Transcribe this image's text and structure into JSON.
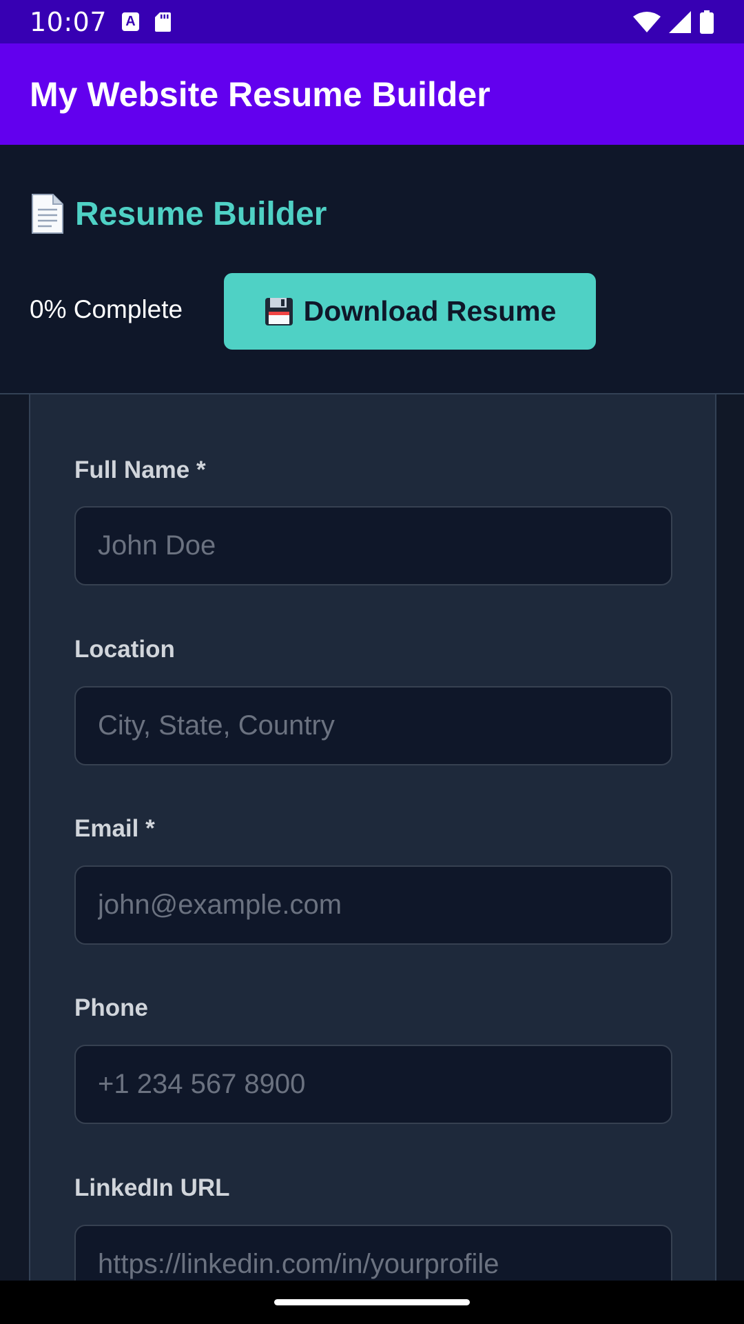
{
  "status_bar": {
    "time": "10:07",
    "left_icons": [
      "text-input-icon",
      "sd-card-icon"
    ],
    "right_icons": [
      "wifi-icon",
      "signal-icon",
      "battery-icon"
    ]
  },
  "app_bar": {
    "title": "My Website Resume Builder"
  },
  "header": {
    "icon": "document-icon",
    "title": "Resume Builder",
    "progress_text": "0% Complete",
    "download_button": {
      "icon": "floppy-disk-icon",
      "label": "Download Resume"
    }
  },
  "form": {
    "fields": [
      {
        "label": "Full Name *",
        "placeholder": "John Doe",
        "value": ""
      },
      {
        "label": "Location",
        "placeholder": "City, State, Country",
        "value": ""
      },
      {
        "label": "Email *",
        "placeholder": "john@example.com",
        "value": ""
      },
      {
        "label": "Phone",
        "placeholder": "+1 234 567 8900",
        "value": ""
      },
      {
        "label": "LinkedIn URL",
        "placeholder": "https://linkedin.com/in/yourprofile",
        "value": ""
      }
    ]
  },
  "colors": {
    "status_bar": "#3700b3",
    "app_bar": "#6200ee",
    "accent": "#4fd1c5",
    "background": "#111827",
    "card": "#1e293b",
    "input_bg": "#0f1729"
  }
}
